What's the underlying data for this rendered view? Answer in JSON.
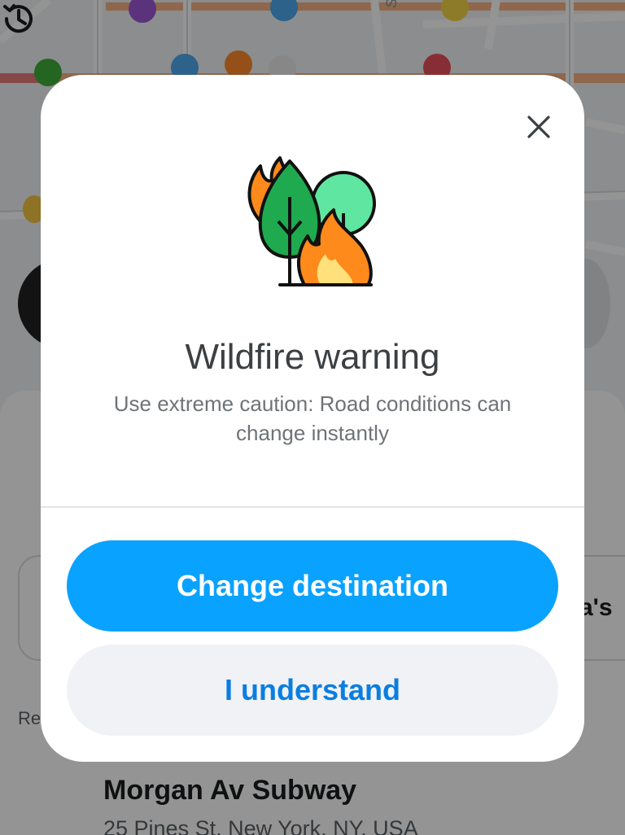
{
  "map": {
    "street_label": "Spruce",
    "right_card_text": "a's",
    "recent_label": "Re",
    "recent_place": {
      "name": "Morgan Av Subway",
      "address": "25 Pines St, New York, NY, USA"
    }
  },
  "dialog": {
    "icon": "wildfire-illustration",
    "title": "Wildfire warning",
    "message": "Use extreme caution: Road conditions can change instantly",
    "close_icon": "close-icon",
    "primary_button": "Change destination",
    "secondary_button": "I understand"
  },
  "colors": {
    "primary": "#0aa2ff",
    "secondary_bg": "#f1f2f6",
    "secondary_text": "#0a7ee0",
    "fire_orange": "#ff8a1c",
    "fire_yellow": "#ffe07a",
    "tree_green": "#1faa4f",
    "tree_light_green": "#5fe6a0"
  }
}
